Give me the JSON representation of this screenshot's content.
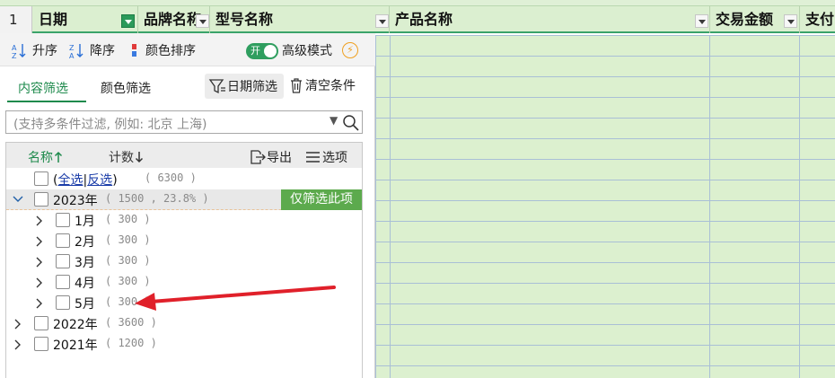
{
  "sheet": {
    "row_number": "1",
    "columns": [
      {
        "label": "日期"
      },
      {
        "label": "品牌名称"
      },
      {
        "label": "型号名称"
      },
      {
        "label": "产品名称"
      },
      {
        "label": "交易金额"
      },
      {
        "label": "支付"
      }
    ]
  },
  "toolbar": {
    "sort_asc": "升序",
    "sort_desc": "降序",
    "color_sort": "颜色排序",
    "toggle_text": "开",
    "advanced_mode": "高级模式",
    "bolt_glyph": "⚡"
  },
  "tabs": {
    "content_filter": "内容筛选",
    "color_filter": "颜色筛选",
    "date_filter": "日期筛选",
    "clear_conditions": "清空条件"
  },
  "search": {
    "placeholder": "(支持多条件过滤, 例如: 北京 上海)"
  },
  "list_header": {
    "name": "名称",
    "count": "计数",
    "export": "导出",
    "options": "选项"
  },
  "items": {
    "all": {
      "select_all": "全选",
      "sep": "|",
      "invert": "反选",
      "open": "(",
      "close": ")",
      "count": "( 6300 )"
    },
    "y2023": {
      "label": "2023年",
      "count": "( 1500 , 23.8% )",
      "only_button": "仅筛选此项"
    },
    "months": [
      {
        "label": "1月",
        "count": "( 300 )"
      },
      {
        "label": "2月",
        "count": "( 300 )"
      },
      {
        "label": "3月",
        "count": "( 300 )"
      },
      {
        "label": "4月",
        "count": "( 300 )"
      },
      {
        "label": "5月",
        "count": "( 300 )"
      }
    ],
    "y2022": {
      "label": "2022年",
      "count": "( 3600 )"
    },
    "y2021": {
      "label": "2021年",
      "count": "( 1200 )"
    }
  },
  "colors": {
    "accent_green": "#1e8a4c",
    "only_button_bg": "#5caa4d",
    "annotation_arrow": "#e0202a",
    "grid_fill": "#dcf0cf"
  }
}
